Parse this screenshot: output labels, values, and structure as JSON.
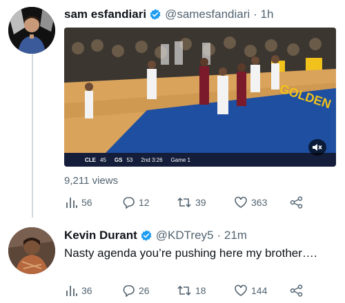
{
  "tweet": {
    "display_name": "sam esfandiari",
    "handle": "@samesfandiari",
    "time": "· 1h",
    "video": {
      "team1": "CLE",
      "score1": "45",
      "team2": "GS",
      "score2": "53",
      "period": "2nd 3:26",
      "series_label": "Game 1",
      "court_text": "GOLDEN"
    },
    "views": "9,211 views",
    "stats": {
      "views": "56",
      "replies": "12",
      "retweets": "39",
      "likes": "363"
    }
  },
  "reply": {
    "display_name": "Kevin Durant",
    "handle": "@KDTrey5",
    "time": "· 21m",
    "text": "Nasty agenda you’re pushing here my brother….",
    "stats": {
      "views": "36",
      "replies": "26",
      "retweets": "18",
      "likes": "144"
    }
  },
  "colors": {
    "verified": "#1d9bf0",
    "secondary_text": "#536471",
    "thread_line": "#cfd9de"
  }
}
